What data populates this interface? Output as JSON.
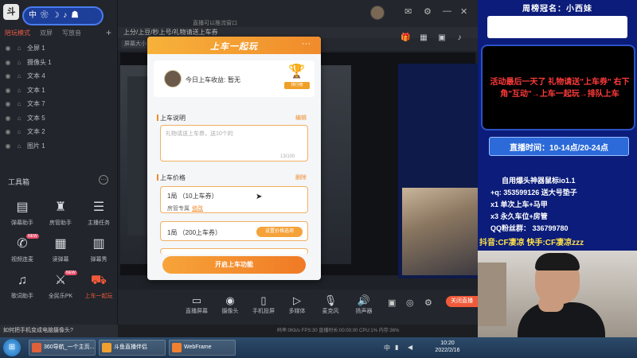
{
  "app": {
    "user_chip": "中 ❀ ☽ ♪ ☗",
    "scene_tabs": [
      "陪玩模式",
      "双屏",
      "写放音"
    ],
    "active_scene": 0,
    "layers": [
      "全屏 1",
      "摄像头 1",
      "文本 4",
      "文本 1",
      "文本 7",
      "文本 5",
      "文本 2",
      "图片 1"
    ],
    "toolbox_title": "工具箱",
    "tools": [
      {
        "label": "弹幕助手",
        "icon": "▤"
      },
      {
        "label": "房管助手",
        "icon": "♜"
      },
      {
        "label": "主播任务",
        "icon": "☰"
      },
      {
        "label": "视频连麦",
        "icon": "✆",
        "badge": "NEW"
      },
      {
        "label": "读弹幕",
        "icon": "▦"
      },
      {
        "label": "弹幕秀",
        "icon": "▥"
      },
      {
        "label": "歌词助手",
        "icon": "♫"
      },
      {
        "label": "全民乐PK",
        "icon": "⚔",
        "badge": "NEW"
      },
      {
        "label": "上车一起玩",
        "icon": "⛟",
        "active": true
      }
    ]
  },
  "topbar": {
    "preview_url": "直播可以推流窗口",
    "info_text": "上分/上豆/秒上号/礼物请送上车券",
    "source_pill": "屏幕大小"
  },
  "popup": {
    "title": "上车一起玩",
    "more": "···",
    "income_label": "今日上车收益:",
    "income_value": "暂无",
    "trophy_label": "排行榜",
    "desc_title": "上车说明",
    "desc_edit": "编辑",
    "desc_placeholder": "礼物请送上车券，送10个的",
    "desc_count": "13/100",
    "price_title": "上车价格",
    "price_delete": "删除",
    "price_options": [
      {
        "main": "1局  （10上车券）",
        "sub": "房管专属",
        "sub_link": "修改"
      },
      {
        "main": "1局  （200上车券）",
        "button": "设置价格选项"
      }
    ],
    "start_button": "开启上车功能"
  },
  "bottom_tools": [
    {
      "label": "直播屏幕",
      "icon": "▭"
    },
    {
      "label": "摄像头",
      "icon": "◉"
    },
    {
      "label": "手机投屏",
      "icon": "▯"
    },
    {
      "label": "多媒体",
      "icon": "▷"
    },
    {
      "label": "麦克风",
      "icon": "🎙"
    },
    {
      "label": "扬声器",
      "icon": "🔊"
    }
  ],
  "go_live": "关闭直播",
  "statusbar": "码率:0Kb/s    FPS:30    直播时长:00:00:00    CPU:1%    内存:36%",
  "notice": "如何把手机变成电脑摄像头?",
  "overlay": {
    "champion_label": "周榜冠名：",
    "champion_name": "小西妹",
    "announce": "活动最后一天了 礼物请送\"上车券\" 右下角\"互动\"→上车一起玩→排队上车",
    "time_label": "直播时间：10-14点/20-24点",
    "info_lines": [
      "自用爆头神器鼠标io1.1",
      "+q: 353599126  送大号垫子",
      "x1  单次上车+马甲",
      "x3  永久车位+房管",
      "QQ粉丝群： 336799780"
    ],
    "douyin": "抖音:CF凄凉  快手:CF凄凉zzz"
  },
  "taskbar": {
    "tasks": [
      {
        "label": "360导航_一个主页...",
        "color": "#e0603a"
      },
      {
        "label": "斗鱼直播伴侣",
        "color": "#f0a030"
      },
      {
        "label": "WebFrame",
        "color": "#f08030"
      }
    ],
    "time": "10:20",
    "date": "2022/2/16"
  }
}
